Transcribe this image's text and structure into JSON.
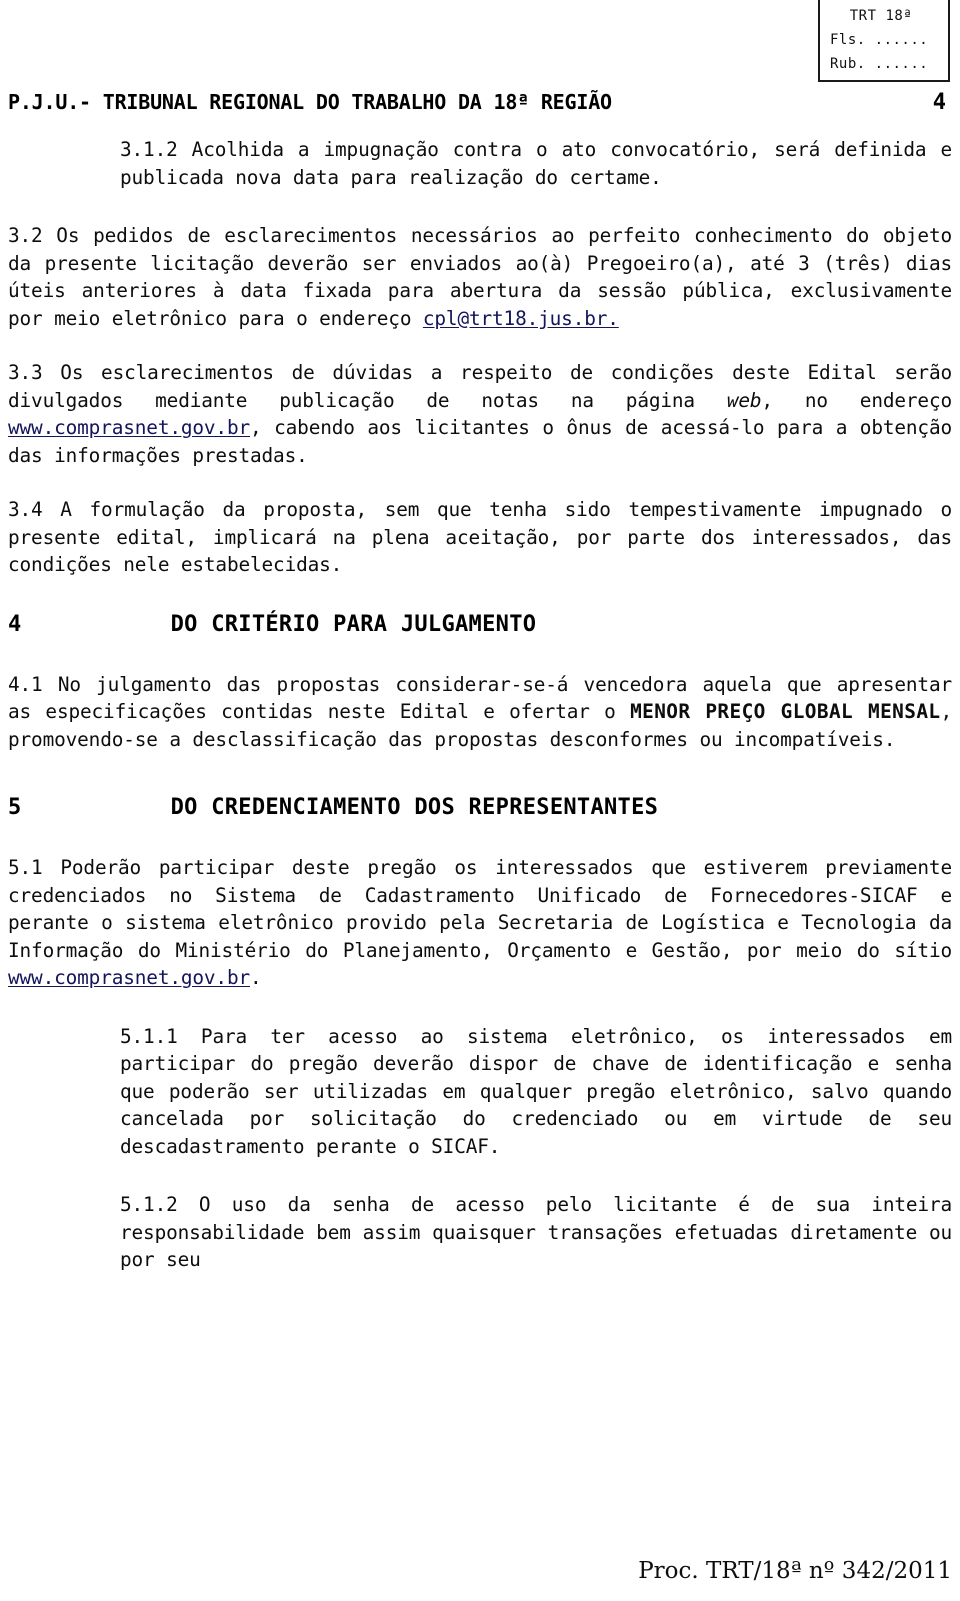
{
  "document": {
    "page_number": "4",
    "header_title": "P.J.U.- TRIBUNAL REGIONAL DO TRABALHO DA 18ª REGIÃO",
    "footer": "Proc. TRT/18ª nº 342/2011"
  },
  "stamp": {
    "title": "TRT 18ª",
    "line_fls": "Fls. ......",
    "line_rub": "Rub. ......"
  },
  "content": {
    "p_3_1_2": "3.1.2   Acolhida a impugnação contra o ato convocatório, será definida e publicada nova data para realização do certame.",
    "p_3_2_part1": "3.2     Os pedidos de esclarecimentos necessários ao perfeito conhecimento do objeto da presente licitação deverão ser enviados ao(à) Pregoeiro(a), até 3 (três) dias úteis anteriores à data fixada para abertura da sessão pública, exclusivamente por meio eletrônico para o endereço ",
    "p_3_2_link": "cpl@trt18.jus.br.",
    "p_3_3_part1": "3.3     Os esclarecimentos de dúvidas a respeito de condições deste Edital serão divulgados mediante publicação de notas na página ",
    "p_3_3_italic": "web",
    "p_3_3_part2": ", no endereço ",
    "p_3_3_link": "www.comprasnet.gov.br",
    "p_3_3_part3": ", cabendo aos licitantes o ônus de acessá-lo para a obtenção das informações prestadas.",
    "p_3_4": "3.4     A formulação da proposta, sem que tenha sido tempestivamente impugnado o presente edital, implicará na plena aceitação, por parte dos interessados, das condições nele estabelecidas.",
    "head_4_number": "4",
    "head_4_title": "DO CRITÉRIO PARA JULGAMENTO",
    "p_4_1_part1": "4.1     No julgamento das propostas considerar-se-á vencedora aquela que apresentar as especificações contidas neste Edital e ofertar o ",
    "p_4_1_bold": "MENOR PREÇO GLOBAL MENSAL",
    "p_4_1_part2": ", promovendo-se a desclassificação das propostas desconformes ou incompatíveis.",
    "head_5_number": "5",
    "head_5_title": "DO CREDENCIAMENTO DOS REPRESENTANTES",
    "p_5_1_part1": "5.1 Poderão participar deste pregão os interessados que estiverem previamente credenciados no Sistema de Cadastramento Unificado de Fornecedores-SICAF e perante o sistema eletrônico provido pela Secretaria de Logística e Tecnologia da Informação do Ministério do Planejamento, Orçamento e Gestão, por meio do sítio ",
    "p_5_1_link": "www.comprasnet.gov.br",
    "p_5_1_part2": ".",
    "p_5_1_1": "5.1.1    Para ter acesso ao sistema eletrônico, os interessados em participar do pregão deverão dispor de chave de identificação e senha que poderão ser utilizadas em qualquer pregão eletrônico, salvo quando cancelada por solicitação do credenciado ou em virtude de seu descadastramento perante o SICAF.",
    "p_5_1_2": "5.1.2    O uso da senha de acesso pelo licitante é de sua inteira responsabilidade bem assim quaisquer transações efetuadas diretamente ou por seu"
  },
  "colors": {
    "text": "#0d0d0d",
    "link": "#14145a",
    "page_background": "#ffffff",
    "stamp_border": "#1a1a1a"
  }
}
